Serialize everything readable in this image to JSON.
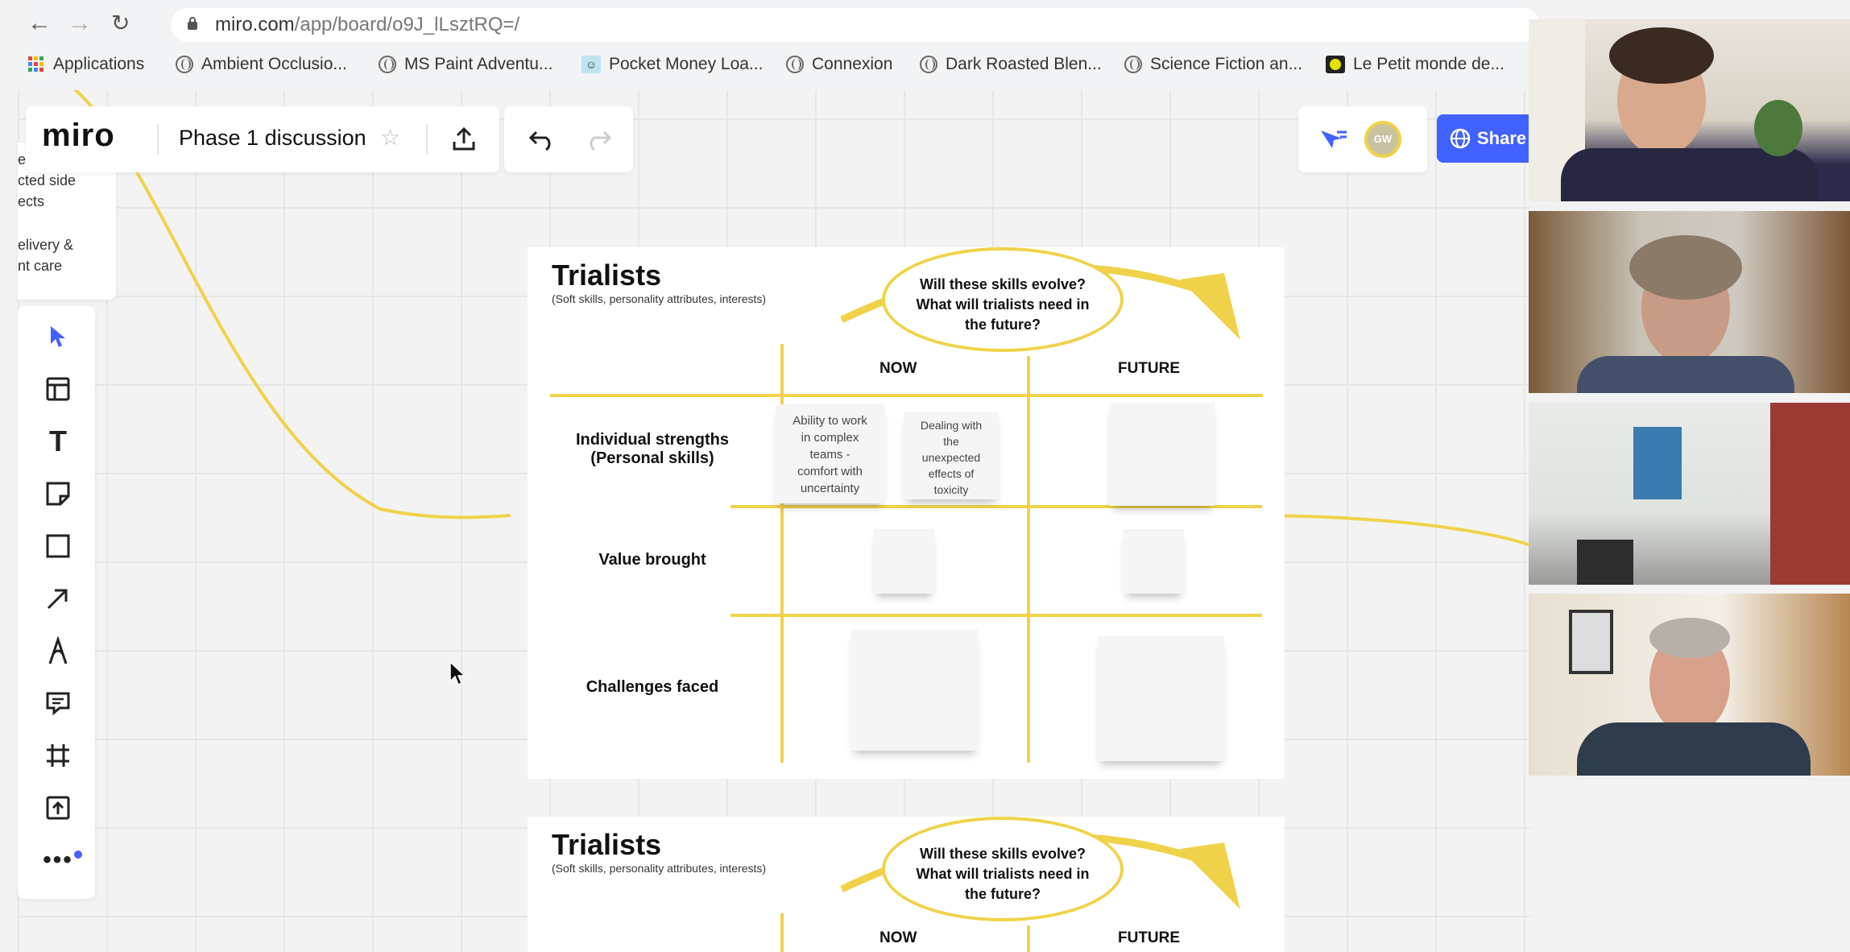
{
  "browser": {
    "url_host": "miro.com",
    "url_path": "/app/board/o9J_lLsztRQ=/",
    "bookmarks": [
      "Applications",
      "Ambient Occlusio...",
      "MS Paint Adventu...",
      "Pocket Money Loa...",
      "Connexion",
      "Dark Roasted Blen...",
      "Science Fiction an...",
      "Le Petit monde de..."
    ]
  },
  "toolbar": {
    "logo": "miro",
    "board_title": "Phase 1 discussion",
    "share_label": "Share",
    "avatar_initials": "GW"
  },
  "left_fragment": {
    "line1": "e",
    "line2": "cted side",
    "line3": "ects",
    "line4": "elivery &",
    "line5": "nt care"
  },
  "frame1": {
    "title": "Trialists",
    "subtitle": "(Soft skills, personality attributes, interests)",
    "question": [
      "Will these skills evolve?",
      "What will trialists need in",
      "the future?"
    ],
    "col_now": "NOW",
    "col_future": "FUTURE",
    "row1": [
      "Individual strengths",
      "(Personal skills)"
    ],
    "row2": "Value brought",
    "row3": "Challenges faced",
    "sticky1": [
      "Ability to work",
      "in complex",
      "teams -",
      "comfort  with",
      "uncertainty"
    ],
    "sticky2": [
      "Dealing with",
      "the",
      "unexpected",
      "effects of",
      "toxicity"
    ]
  },
  "frame2": {
    "title": "Trialists",
    "subtitle": "(Soft skills, personality attributes, interests)",
    "question": [
      "Will these skills evolve?",
      "What will trialists need in",
      "the future?"
    ],
    "col_now": "NOW",
    "col_future": "FUTURE"
  },
  "colors": {
    "accent": "#f0d24a",
    "share": "#4262ff",
    "tool_select": "#4262ff"
  }
}
